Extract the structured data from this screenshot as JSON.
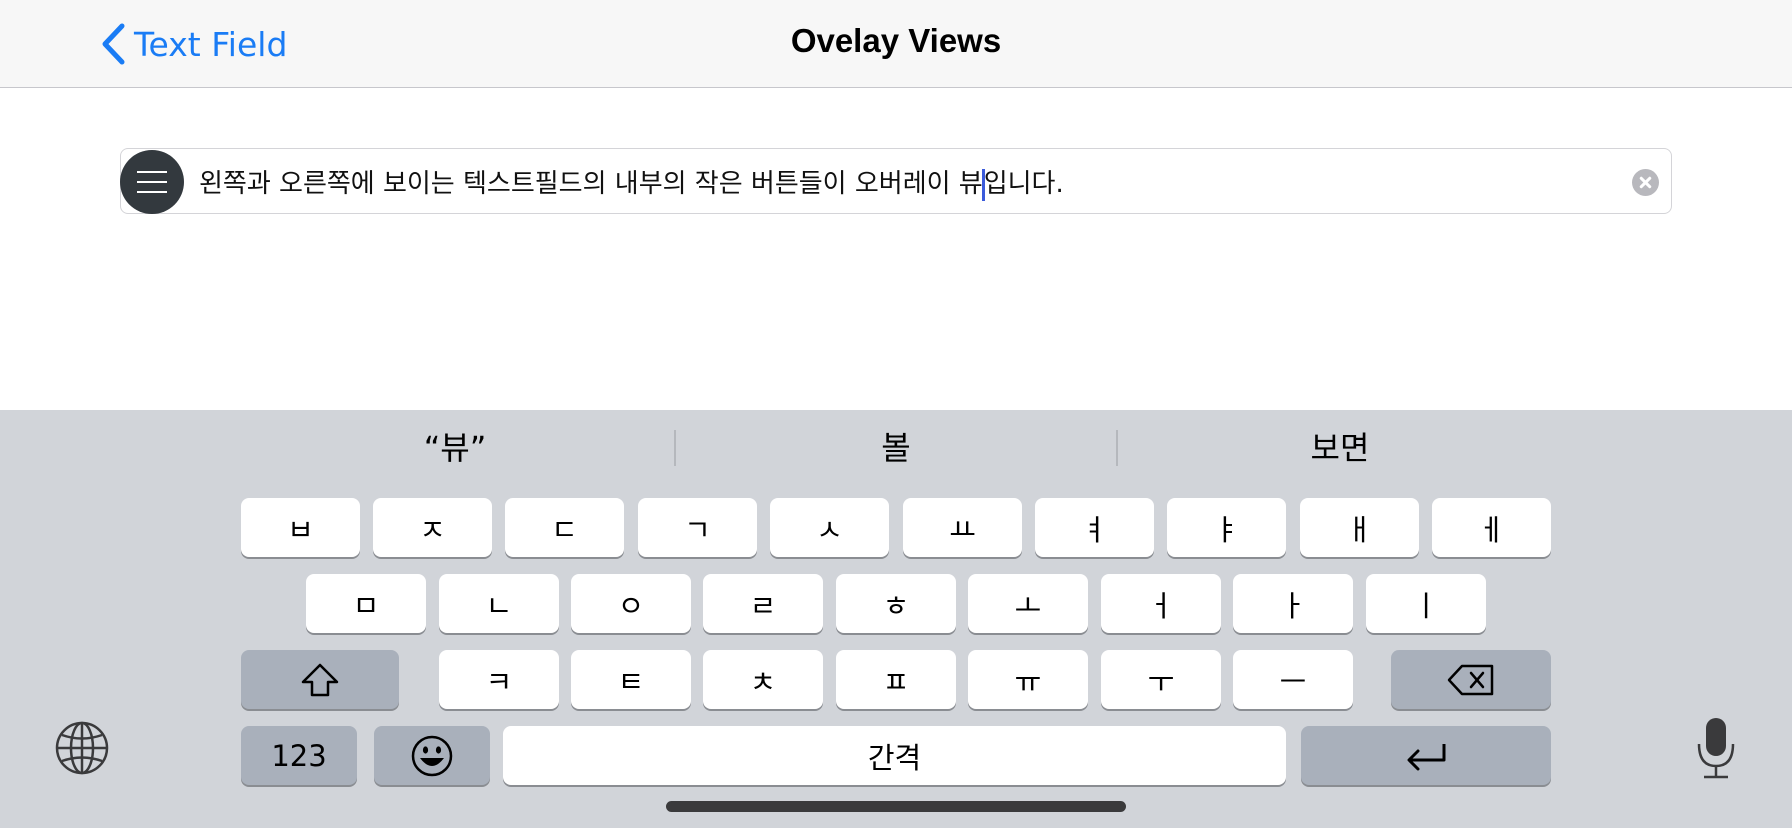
{
  "nav": {
    "back_label": "Text Field",
    "title": "Ovelay Views"
  },
  "text_field": {
    "value_before_caret": "왼쪽과 오른쪽에 보이는 텍스트필드의 내부의 작은 버튼들이 오버레이 뷰",
    "value_after_caret": "입니다."
  },
  "suggestions": [
    "“뷰”",
    "볼",
    "보면"
  ],
  "keyboard": {
    "row1": [
      "ㅂ",
      "ㅈ",
      "ㄷ",
      "ㄱ",
      "ㅅ",
      "ㅛ",
      "ㅕ",
      "ㅑ",
      "ㅐ",
      "ㅔ"
    ],
    "row2": [
      "ㅁ",
      "ㄴ",
      "ㅇ",
      "ㄹ",
      "ㅎ",
      "ㅗ",
      "ㅓ",
      "ㅏ",
      "ㅣ"
    ],
    "row3": [
      "ㅋ",
      "ㅌ",
      "ㅊ",
      "ㅍ",
      "ㅠ",
      "ㅜ",
      "ㅡ"
    ],
    "numbers_label": "123",
    "space_label": "간격",
    "icons": {
      "shift": "shift-icon",
      "delete": "backspace-icon",
      "emoji": "emoji-icon",
      "return": "return-icon",
      "globe": "globe-icon",
      "mic": "microphone-icon"
    }
  },
  "colors": {
    "accent": "#1a7cf5",
    "keyboard_bg": "#d1d4d9",
    "dark_key": "#a9b0bb",
    "menu_button": "#33393e"
  }
}
